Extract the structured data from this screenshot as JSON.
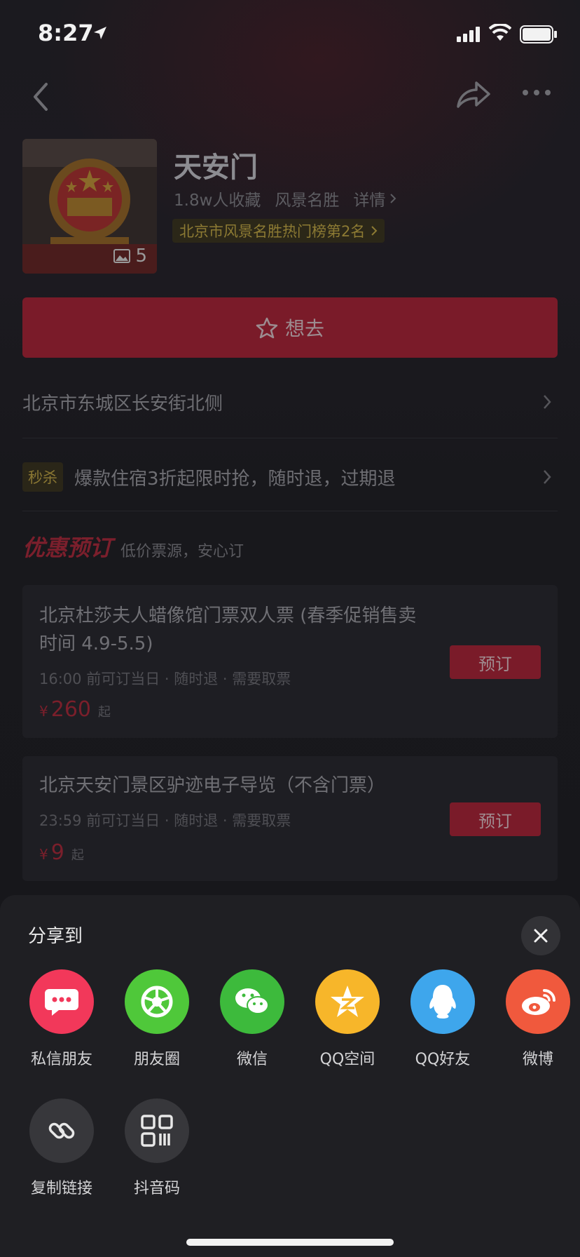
{
  "status": {
    "time": "8:27"
  },
  "poi": {
    "title": "天安门",
    "favorites": "1.8w人收藏",
    "category": "风景名胜",
    "detail_label": "详情",
    "rank": "北京市风景名胜热门榜第2名",
    "photo_count": "5"
  },
  "want_button": {
    "label": "想去"
  },
  "address": "北京市东城区长安街北侧",
  "flash_sale": {
    "tag": "秒杀",
    "text": "爆款住宿3折起限时抢，随时退，过期退"
  },
  "section": {
    "title": "优惠预订",
    "subtitle": "低价票源，安心订"
  },
  "tickets": [
    {
      "name": "北京杜莎夫人蜡像馆门票双人票 (春季促销售卖时间 4.9-5.5)",
      "conditions": "16:00 前可订当日 · 随时退 · 需要取票",
      "price_symbol": "¥",
      "price": "260",
      "price_suffix": "起",
      "book_label": "预订"
    },
    {
      "name": "北京天安门景区驴迹电子导览（不含门票）",
      "conditions": "23:59 前可订当日 · 随时退 · 需要取票",
      "price_symbol": "¥",
      "price": "9",
      "price_suffix": "起",
      "book_label": "预订"
    }
  ],
  "share_sheet": {
    "title": "分享到",
    "row1": [
      {
        "label": "私信朋友",
        "icon": "chat-bubble-icon",
        "color": "#f2385a"
      },
      {
        "label": "朋友圈",
        "icon": "moments-icon",
        "color": "#4fc83a"
      },
      {
        "label": "微信",
        "icon": "wechat-icon",
        "color": "#3dba3c"
      },
      {
        "label": "QQ空间",
        "icon": "qzone-icon",
        "color": "#f7b62a"
      },
      {
        "label": "QQ好友",
        "icon": "qq-icon",
        "color": "#3ea6ec"
      },
      {
        "label": "微博",
        "icon": "weibo-icon",
        "color": "#f0593d"
      }
    ],
    "row2": [
      {
        "label": "复制链接",
        "icon": "link-icon",
        "color": "#37373b"
      },
      {
        "label": "抖音码",
        "icon": "qr-code-icon",
        "color": "#37373b"
      }
    ]
  },
  "colors": {
    "accent_red": "#7a1b29",
    "sheet_bg": "#1f1f23"
  }
}
